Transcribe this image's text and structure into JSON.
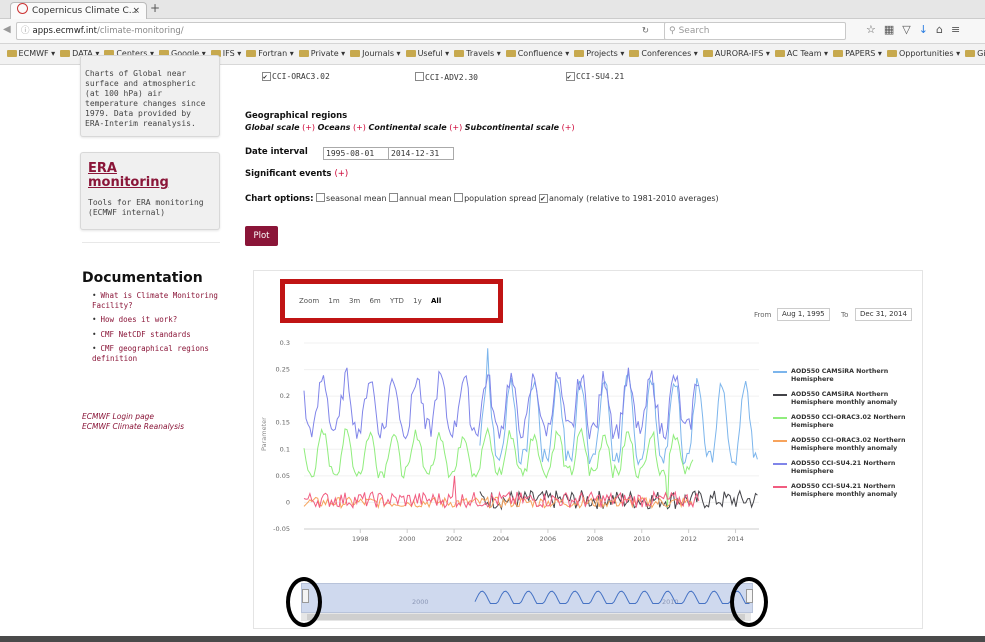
{
  "browser": {
    "tab_title": "Copernicus Climate C...",
    "tab_close": "×",
    "new_tab": "+",
    "url_domain": "apps.ecmwf.int",
    "url_path": "/climate-monitoring/",
    "search_placeholder": "Search",
    "icons": [
      "star-icon",
      "bookmark-icon",
      "pocket-icon",
      "download-icon",
      "home-icon",
      "menu-icon"
    ]
  },
  "bookmarks": [
    "ECMWF",
    "DATA",
    "Centers",
    "Google",
    "IFS",
    "Fortran",
    "Private",
    "Journals",
    "Useful",
    "Travels",
    "Confluence",
    "Projects",
    "Conferences",
    "AURORA-IFS",
    "AC Team",
    "PAPERS",
    "Opportunities",
    "Git"
  ],
  "sidebar": {
    "card1_text": "Charts of Global near surface and atmospheric (at 100 hPa) air temperature changes since 1979. Data provided by ERA-Interim reanalysis.",
    "era_title_1": "ERA",
    "era_title_2": "monitoring",
    "era_desc": "Tools for ERA monitoring (ECMWF internal)",
    "doc_title": "Documentation",
    "doc_links": [
      "What is Climate Monitoring Facility?",
      "How does it work?",
      "CMF NetCDF standards",
      "CMF geographical regions definition"
    ],
    "login_link": "ECMWF Login page",
    "reanalysis_link": "ECMWF Climate Reanalysis"
  },
  "form": {
    "datasets": [
      {
        "label": "CCI-ORAC3.02",
        "checked": true
      },
      {
        "label": "CCI-ADV2.30",
        "checked": false
      },
      {
        "label": "CCI-SU4.21",
        "checked": true
      }
    ],
    "geo_label": "Geographical regions",
    "geo_items": [
      "Global scale",
      "Oceans",
      "Continental scale",
      "Subcontinental scale"
    ],
    "plus": "(+)",
    "date_label": "Date interval",
    "date_from": "1995-08-01",
    "date_to": "2014-12-31",
    "events_label": "Significant events",
    "chart_options_label": "Chart options:",
    "options": [
      {
        "label": "seasonal mean",
        "checked": false
      },
      {
        "label": "annual mean",
        "checked": false
      },
      {
        "label": "population spread",
        "checked": false
      },
      {
        "label": "anomaly (relative to 1981-2010 averages)",
        "checked": true
      }
    ],
    "plot_button": "Plot"
  },
  "chart": {
    "zoom_label": "Zoom",
    "zoom_buttons": [
      "1m",
      "3m",
      "6m",
      "YTD",
      "1y",
      "All"
    ],
    "from_label": "From",
    "from_value": "Aug 1, 1995",
    "to_label": "To",
    "to_value": "Dec 31, 2014",
    "navigator_labels": [
      "2000",
      "2010"
    ]
  },
  "chart_data": {
    "type": "line",
    "ylabel": "Parameter",
    "ylim": [
      -0.05,
      0.3
    ],
    "yticks": [
      "0.3",
      "0.25",
      "0.2",
      "0.15",
      "0.1",
      "0.05",
      "0",
      "-0.05"
    ],
    "xticks": [
      "1998",
      "2000",
      "2002",
      "2004",
      "2006",
      "2008",
      "2010",
      "2012",
      "2014"
    ],
    "xlim": [
      1995.6,
      2015.0
    ],
    "series": [
      {
        "name": "AOD550 CAMSiRA Northern Hemisphere",
        "color": "#7cb5ec",
        "start": 2003.1,
        "end": 2015.0,
        "base": 0.14,
        "amp": 0.09,
        "noise": 0.015
      },
      {
        "name": "AOD550 CAMSiRA Northern Hemisphere monthly anomaly",
        "color": "#434348",
        "start": 2003.1,
        "end": 2015.0,
        "base": 0.005,
        "amp": 0.0,
        "noise": 0.018
      },
      {
        "name": "AOD550 CCI-ORAC3.02 Northern Hemisphere",
        "color": "#90ed7d",
        "start": 1995.6,
        "end": 2012.2,
        "base": 0.085,
        "amp": 0.045,
        "noise": 0.012
      },
      {
        "name": "AOD550 CCI-ORAC3.02 Northern Hemisphere monthly anomaly",
        "color": "#f7a35c",
        "start": 1995.6,
        "end": 2012.2,
        "base": 0.0,
        "amp": 0.0,
        "noise": 0.01
      },
      {
        "name": "AOD550 CCI-SU4.21 Northern Hemisphere",
        "color": "#8085e9",
        "start": 1995.6,
        "end": 2012.5,
        "base": 0.175,
        "amp": 0.06,
        "noise": 0.02
      },
      {
        "name": "AOD550 CCI-SU4.21 Northern Hemisphere monthly anomaly",
        "color": "#f15c80",
        "start": 1995.6,
        "end": 2012.5,
        "base": 0.005,
        "amp": 0.0,
        "noise": 0.015
      }
    ]
  }
}
